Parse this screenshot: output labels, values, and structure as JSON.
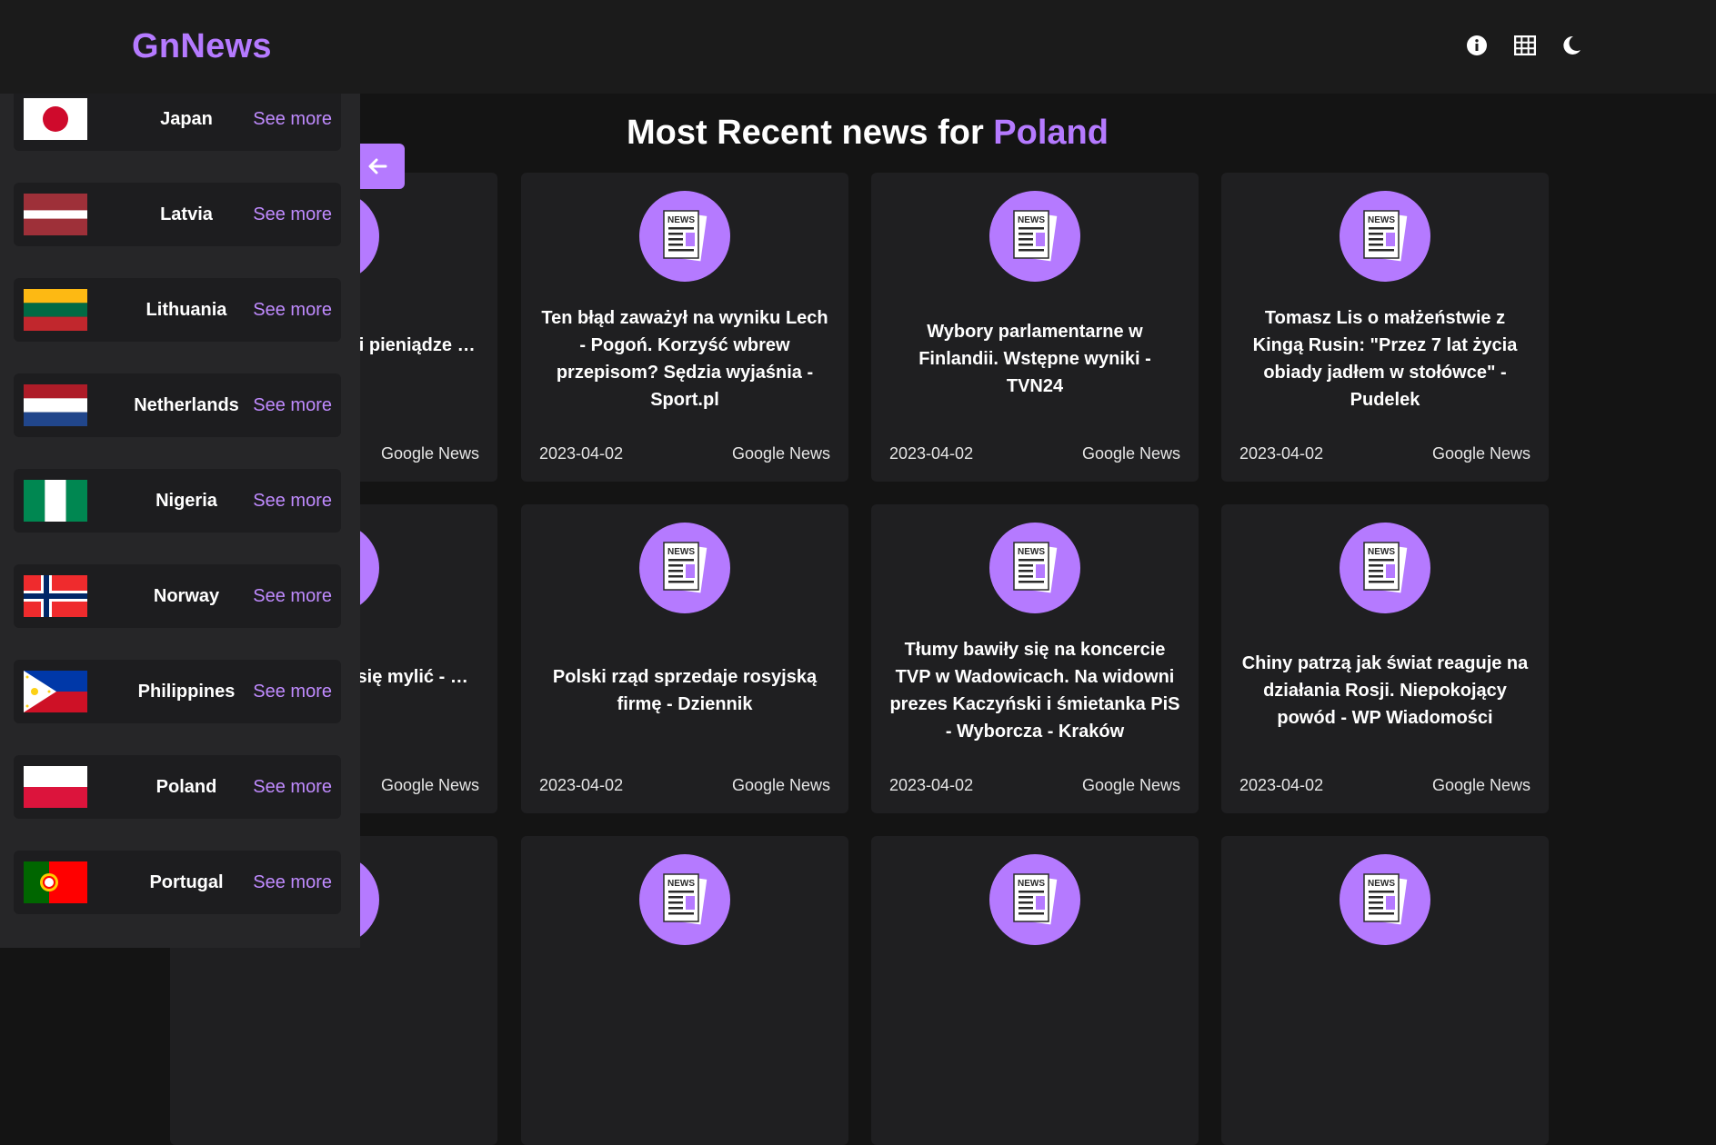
{
  "header": {
    "logo": "GnNews",
    "icons": [
      "info-icon",
      "grid-icon",
      "moon-icon"
    ]
  },
  "main": {
    "title_prefix": "Most Recent news for",
    "title_country": "Poland",
    "news_badge_label": "NEWS",
    "cards": [
      {
        "headline": "…wa bogatych …ali pieniądze …Onet",
        "date": "",
        "source": "Google News"
      },
      {
        "headline": "Ten błąd zaważył na wyniku Lech - Pogoń. Korzyść wbrew przepisom? Sędzia wyjaśnia - Sport.pl",
        "date": "2023-04-02",
        "source": "Google News"
      },
      {
        "headline": "Wybory parlamentarne w Finlandii. Wstępne wyniki - TVN24",
        "date": "2023-04-02",
        "source": "Google News"
      },
      {
        "headline": "Tomasz Lis o małżeństwie z Kingą Rusin: \"Przez 7 lat życia obiady jadłem w stołówce\" - Pudelek",
        "date": "2023-04-02",
        "source": "Google News"
      },
      {
        "headline": "…Pawle II: Cały …się mylić - …vs.pl",
        "date": "",
        "source": "Google News"
      },
      {
        "headline": "Polski rząd sprzedaje rosyjską firmę - Dziennik",
        "date": "2023-04-02",
        "source": "Google News"
      },
      {
        "headline": "Tłumy bawiły się na koncercie TVP w Wadowicach. Na widowni prezes Kaczyński i śmietanka PiS - Wyborcza - Kraków",
        "date": "2023-04-02",
        "source": "Google News"
      },
      {
        "headline": "Chiny patrzą jak świat reaguje na działania Rosji. Niepokojący powód - WP Wiadomości",
        "date": "2023-04-02",
        "source": "Google News"
      },
      {
        "headline": "",
        "date": "",
        "source": ""
      },
      {
        "headline": "",
        "date": "",
        "source": ""
      },
      {
        "headline": "",
        "date": "",
        "source": ""
      },
      {
        "headline": "",
        "date": "",
        "source": ""
      }
    ]
  },
  "sidebar": {
    "see_more_label": "See more",
    "countries": [
      {
        "name": "Japan"
      },
      {
        "name": "Latvia"
      },
      {
        "name": "Lithuania"
      },
      {
        "name": "Netherlands"
      },
      {
        "name": "Nigeria"
      },
      {
        "name": "Norway"
      },
      {
        "name": "Philippines"
      },
      {
        "name": "Poland"
      },
      {
        "name": "Portugal"
      }
    ]
  },
  "colors": {
    "accent": "#b57aff",
    "background": "#141414",
    "card": "#1f1f21",
    "sidebar": "#262628"
  }
}
